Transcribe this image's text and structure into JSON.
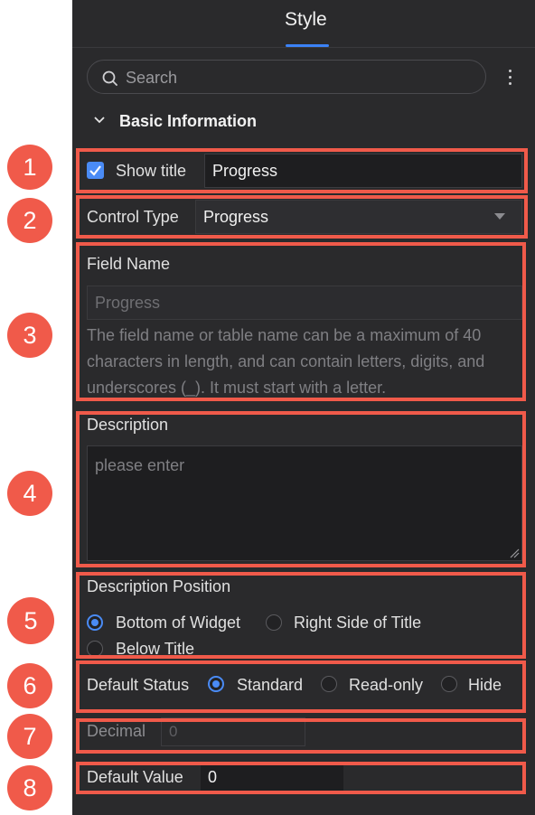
{
  "header": {
    "tab_style": "Style"
  },
  "search": {
    "placeholder": "Search"
  },
  "section": {
    "title": "Basic Information"
  },
  "show_title": {
    "label": "Show title",
    "checked": true,
    "value": "Progress"
  },
  "control_type": {
    "label": "Control Type",
    "value": "Progress"
  },
  "field_name": {
    "label": "Field Name",
    "placeholder": "Progress",
    "help": "The field name or table name can be a maximum of 40 characters in length, and can contain letters, digits, and underscores (_). It must start with a letter."
  },
  "description": {
    "label": "Description",
    "placeholder": "please enter"
  },
  "description_position": {
    "label": "Description Position",
    "options": [
      "Bottom of Widget",
      "Right Side of Title",
      "Below Title"
    ],
    "selected": "Bottom of Widget"
  },
  "default_status": {
    "label": "Default Status",
    "options": [
      "Standard",
      "Read-only",
      "Hide"
    ],
    "selected": "Standard"
  },
  "decimal": {
    "label": "Decimal",
    "placeholder": "0"
  },
  "default_value": {
    "label": "Default Value",
    "value": "0"
  },
  "annotations": [
    "1",
    "2",
    "3",
    "4",
    "5",
    "6",
    "7",
    "8"
  ],
  "colors": {
    "accent": "#4a8bf5",
    "annotation": "#f05a4a",
    "panel": "#2a2a2c"
  }
}
